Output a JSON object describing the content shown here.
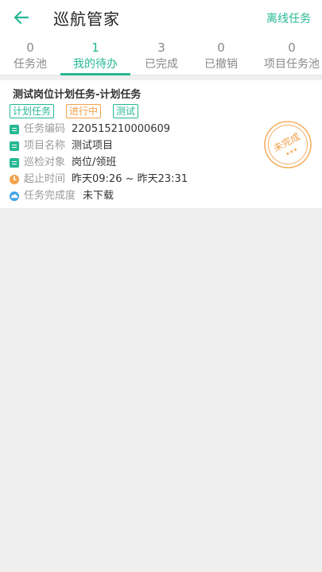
{
  "header": {
    "title": "巡航管家",
    "offline_label": "离线任务",
    "accent_color": "#26b894"
  },
  "tabs": [
    {
      "count": "0",
      "label": "任务池",
      "active": false
    },
    {
      "count": "1",
      "label": "我的待办",
      "active": true
    },
    {
      "count": "3",
      "label": "已完成",
      "active": false
    },
    {
      "count": "0",
      "label": "已撤销",
      "active": false
    },
    {
      "count": "0",
      "label": "项目任务池",
      "active": false
    }
  ],
  "task": {
    "title": "测试岗位计划任务-计划任务",
    "tags": [
      {
        "text": "计划任务",
        "color": "#26b894"
      },
      {
        "text": "进行中",
        "color": "#f2a14a"
      },
      {
        "text": "测试",
        "color": "#26b894"
      }
    ],
    "fields": [
      {
        "icon": "document-icon",
        "label": "任务编码",
        "value": "220515210000609"
      },
      {
        "icon": "document-icon",
        "label": "项目名称",
        "value": "测试项目"
      },
      {
        "icon": "document-icon",
        "label": "巡检对象",
        "value": "岗位/领班"
      },
      {
        "icon": "clock-icon",
        "label": "起止时间",
        "value": "昨天09:26 ~ 昨天23:31"
      },
      {
        "icon": "cloud-icon",
        "label": "任务完成度",
        "value": "未下载"
      }
    ],
    "stamp": {
      "text": "未完成",
      "stars": "★★★",
      "color": "#f2a14a"
    }
  }
}
